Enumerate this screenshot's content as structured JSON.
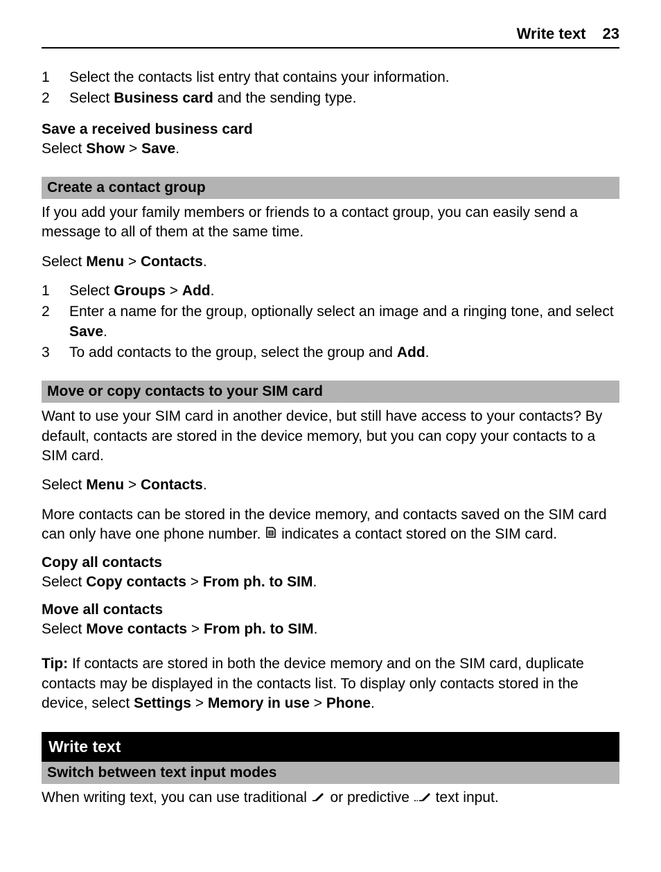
{
  "header": {
    "title": "Write text",
    "page": "23"
  },
  "list1": {
    "item1_num": "1",
    "item1_txt": "Select the contacts list entry that contains your information.",
    "item2_num": "2",
    "item2_pre": "Select ",
    "item2_b": "Business card",
    "item2_post": " and the sending type."
  },
  "save_card": {
    "heading": "Save a received business card",
    "pre": "Select ",
    "b1": "Show",
    "mid": " > ",
    "b2": "Save",
    "post": "."
  },
  "create_group": {
    "bar": "Create a contact group",
    "intro": "If you add your family members or friends to a contact group, you can easily send a message to all of them at the same time.",
    "select_pre": "Select ",
    "select_b1": "Menu",
    "select_mid": " > ",
    "select_b2": "Contacts",
    "select_post": ".",
    "i1_num": "1",
    "i1_pre": "Select ",
    "i1_b1": "Groups",
    "i1_mid": " > ",
    "i1_b2": "Add",
    "i1_post": ".",
    "i2_num": "2",
    "i2_pre": "Enter a name for the group, optionally select an image and a ringing tone, and select ",
    "i2_b": "Save",
    "i2_post": ".",
    "i3_num": "3",
    "i3_pre": "To add contacts to the group, select the group and ",
    "i3_b": "Add",
    "i3_post": "."
  },
  "move_copy": {
    "bar": "Move or copy contacts to your SIM card",
    "intro": "Want to use your SIM card in another device, but still have access to your contacts? By default, contacts are stored in the device memory, but you can copy your contacts to a SIM card.",
    "select_pre": "Select ",
    "select_b1": "Menu",
    "select_mid": " > ",
    "select_b2": "Contacts",
    "select_post": ".",
    "more_pre": "More contacts can be stored in the device memory, and contacts saved on the SIM card can only have one phone number. ",
    "more_post": " indicates a contact stored on the SIM card."
  },
  "copy_all": {
    "heading": "Copy all contacts",
    "pre": "Select ",
    "b1": "Copy contacts",
    "mid": " > ",
    "b2": "From ph. to SIM",
    "post": "."
  },
  "move_all": {
    "heading": "Move all contacts",
    "pre": "Select ",
    "b1": "Move contacts",
    "mid": " > ",
    "b2": "From ph. to SIM",
    "post": "."
  },
  "tip": {
    "label": "Tip:",
    "pre": " If contacts are stored in both the device memory and on the SIM card, duplicate contacts may be displayed in the contacts list. To display only contacts stored in the device, select ",
    "b1": "Settings",
    "mid1": " > ",
    "b2": "Memory in use",
    "mid2": " > ",
    "b3": "Phone",
    "post": "."
  },
  "write_text": {
    "black_bar": "Write text",
    "gray_bar": "Switch between text input modes",
    "p_pre": "When writing text, you can use traditional ",
    "p_mid": " or predictive ",
    "p_post": " text input."
  }
}
